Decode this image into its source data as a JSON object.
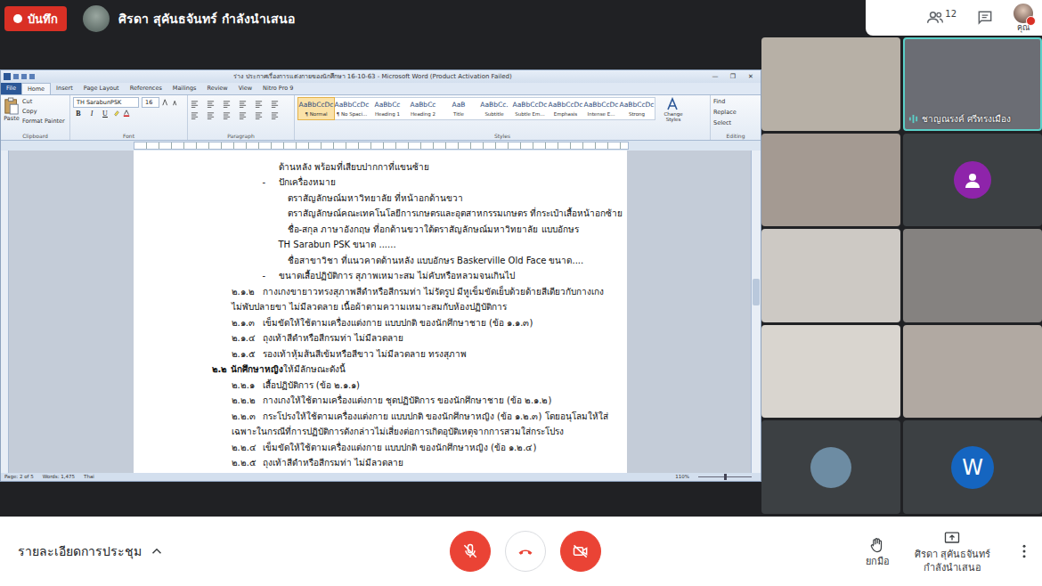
{
  "meeting": {
    "recording_label": "บันทึก",
    "presenter_status": "ศิรดา สุคันธจันทร์ กำลังนำเสนอ",
    "participant_count": "12",
    "self_label": "คุณ"
  },
  "word": {
    "title": "ร่าง ประกาศเรื่องการแต่งกายของนักศึกษา 16-10-63 - Microsoft Word (Product Activation Failed)",
    "window_controls": [
      "—",
      "❐",
      "✕"
    ],
    "tabs": [
      {
        "label": "File",
        "kind": "file",
        "selected": false
      },
      {
        "label": "Home",
        "kind": "tab",
        "selected": true
      },
      {
        "label": "Insert",
        "kind": "tab",
        "selected": false
      },
      {
        "label": "Page Layout",
        "kind": "tab",
        "selected": false
      },
      {
        "label": "References",
        "kind": "tab",
        "selected": false
      },
      {
        "label": "Mailings",
        "kind": "tab",
        "selected": false
      },
      {
        "label": "Review",
        "kind": "tab",
        "selected": false
      },
      {
        "label": "View",
        "kind": "tab",
        "selected": false
      },
      {
        "label": "Nitro Pro 9",
        "kind": "tab",
        "selected": false
      }
    ],
    "clipboard": {
      "paste": "Paste",
      "items": [
        "Cut",
        "Copy",
        "Format Painter"
      ],
      "label": "Clipboard"
    },
    "font": {
      "name": "TH SarabunPSK",
      "size": "16",
      "buttons": [
        "B",
        "I",
        "U"
      ],
      "label": "Font"
    },
    "paragraph": {
      "label": "Paragraph"
    },
    "styles": {
      "items": [
        {
          "preview": "AaBbCcDc",
          "label": "¶ Normal",
          "selected": true
        },
        {
          "preview": "AaBbCcDc",
          "label": "¶ No Spaci...",
          "selected": false
        },
        {
          "preview": "AaBbCc",
          "label": "Heading 1",
          "selected": false
        },
        {
          "preview": "AaBbCc",
          "label": "Heading 2",
          "selected": false
        },
        {
          "preview": "AaB",
          "label": "Title",
          "selected": false
        },
        {
          "preview": "AaBbCc.",
          "label": "Subtitle",
          "selected": false
        },
        {
          "preview": "AaBbCcDc",
          "label": "Subtle Em...",
          "selected": false
        },
        {
          "preview": "AaBbCcDc",
          "label": "Emphasis",
          "selected": false
        },
        {
          "preview": "AaBbCcDc",
          "label": "Intense E...",
          "selected": false
        },
        {
          "preview": "AaBbCcDc",
          "label": "Strong",
          "selected": false
        }
      ],
      "change": "Change Styles",
      "label": "Styles"
    },
    "editing": {
      "items": [
        "Find",
        "Replace",
        "Select"
      ],
      "label": "Editing"
    },
    "document": {
      "lines": [
        {
          "kind": "cont",
          "text": "ด้านหลัง พร้อมที่เสียบปากกาที่แขนซ้าย"
        },
        {
          "kind": "bullet",
          "marker": "-",
          "text": "ปักเครื่องหมาย"
        },
        {
          "kind": "sub",
          "text": "ตราสัญลักษณ์มหาวิทยาลัย  ที่หน้าอกด้านขวา"
        },
        {
          "kind": "sub",
          "text": "ตราสัญลักษณ์คณะเทคโนโลยีการเกษตรและอุตสาหกรรมเกษตร ที่กระเป๋าเสื้อหน้าอกซ้าย"
        },
        {
          "kind": "sub",
          "text": "ชื่อ-สกุล ภาษาอังกฤษ ที่อกด้านขวาใต้ตราสัญลักษณ์มหาวิทยาลัย แบบอักษร"
        },
        {
          "kind": "cont",
          "text": "TH Sarabun PSK ขนาด ......"
        },
        {
          "kind": "sub",
          "text": "ชื่อสาขาวิชา ที่แนวคาดด้านหลัง แบบอักษร Baskerville Old Face ขนาด...."
        },
        {
          "kind": "bullet",
          "marker": "-",
          "text": "ขนาดเสื้อปฏิบัติการ สุภาพเหมาะสม ไม่คับหรือหลวมจนเกินไป"
        },
        {
          "kind": "item",
          "num": "๒.๑.๒",
          "text": "กางเกงขายาวทรงสุภาพสีดำหรือสีกรมท่า ไม่รัดรูป มีหูเข็มขัดเย็บด้วยด้ายสีเดียวกับกางเกง"
        },
        {
          "kind": "wrap",
          "text": "ไม่พับปลายขา ไม่มีลวดลาย เนื้อผ้าตามความเหมาะสมกับห้องปฏิบัติการ"
        },
        {
          "kind": "item",
          "num": "๒.๑.๓",
          "text": "เข็มขัดให้ใช้ตามเครื่องแต่งกาย แบบปกติ ของนักศึกษาชาย (ข้อ ๑.๑.๓)"
        },
        {
          "kind": "item",
          "num": "๒.๑.๔",
          "text": "ถุงเท้าสีดำหรือสีกรมท่า ไม่มีลวดลาย"
        },
        {
          "kind": "item",
          "num": "๒.๑.๕",
          "text": "รองเท้าหุ้มส้นสีเข้มหรือสีขาว ไม่มีลวดลาย ทรงสุภาพ"
        },
        {
          "kind": "heading",
          "num": "๒.๒ นักศึกษาหญิง",
          "text": " ให้มีลักษณะดังนี้"
        },
        {
          "kind": "item",
          "num": "๒.๒.๑",
          "text": "เสื้อปฏิบัติการ (ข้อ ๒.๑.๑)"
        },
        {
          "kind": "item",
          "num": "๒.๒.๒",
          "text": "กางเกงให้ใช้ตามเครื่องแต่งกาย ชุดปฏิบัติการ ของนักศึกษาชาย (ข้อ ๒.๑.๒)"
        },
        {
          "kind": "item",
          "num": "๒.๒.๓",
          "text": "กระโปรงให้ใช้ตามเครื่องแต่งกาย แบบปกติ ของนักศึกษาหญิง (ข้อ ๑.๒.๓) โดยอนุโลมให้ใส่"
        },
        {
          "kind": "wrap",
          "text": "เฉพาะในกรณีที่การปฏิบัติการดังกล่าวไม่เสี่ยงต่อการเกิดอุบัติเหตุจากการสวมใส่กระโปรง"
        },
        {
          "kind": "item",
          "num": "๒.๒.๔",
          "text": "เข็มขัดให้ใช้ตามเครื่องแต่งกาย แบบปกติ ของนักศึกษาหญิง (ข้อ ๑.๒.๔)"
        },
        {
          "kind": "item",
          "num": "๒.๒.๕",
          "text": "ถุงเท้าสีดำหรือสีกรมท่า ไม่มีลวดลาย"
        }
      ]
    },
    "status": {
      "page": "Page: 2 of 5",
      "words": "Words: 1,475",
      "language": "Thai",
      "zoom": "110%",
      "zoom_level": 0.5
    }
  },
  "tiles": [
    {
      "kind": "video",
      "color": "#b7b0a6",
      "speaking": false
    },
    {
      "kind": "video",
      "color": "#6b6d74",
      "speaking": true,
      "name": "ชาญณรงค์ ศรีทรงเมือง"
    },
    {
      "kind": "video",
      "color": "#a49a92",
      "speaking": false
    },
    {
      "kind": "avatar-icon",
      "color": "#8e24aa",
      "speaking": false
    },
    {
      "kind": "video",
      "color": "#cdc9c4",
      "speaking": false
    },
    {
      "kind": "video",
      "color": "#858280",
      "speaking": false
    },
    {
      "kind": "video",
      "color": "#d9d5cf",
      "speaking": false
    },
    {
      "kind": "video",
      "color": "#b1a9a2",
      "speaking": false
    },
    {
      "kind": "photo-avatar",
      "color": "#6d8ca3",
      "speaking": false
    },
    {
      "kind": "letter-avatar",
      "color": "#1565c0",
      "letter": "W",
      "speaking": false
    }
  ],
  "bottom": {
    "details": "รายละเอียดการประชุม",
    "raise_hand": "ยกมือ",
    "presenter_name": "ศิรดา สุคันธจันทร์",
    "presenter_state": "กำลังนำเสนอ",
    "mic_muted": true,
    "camera_off": true
  }
}
